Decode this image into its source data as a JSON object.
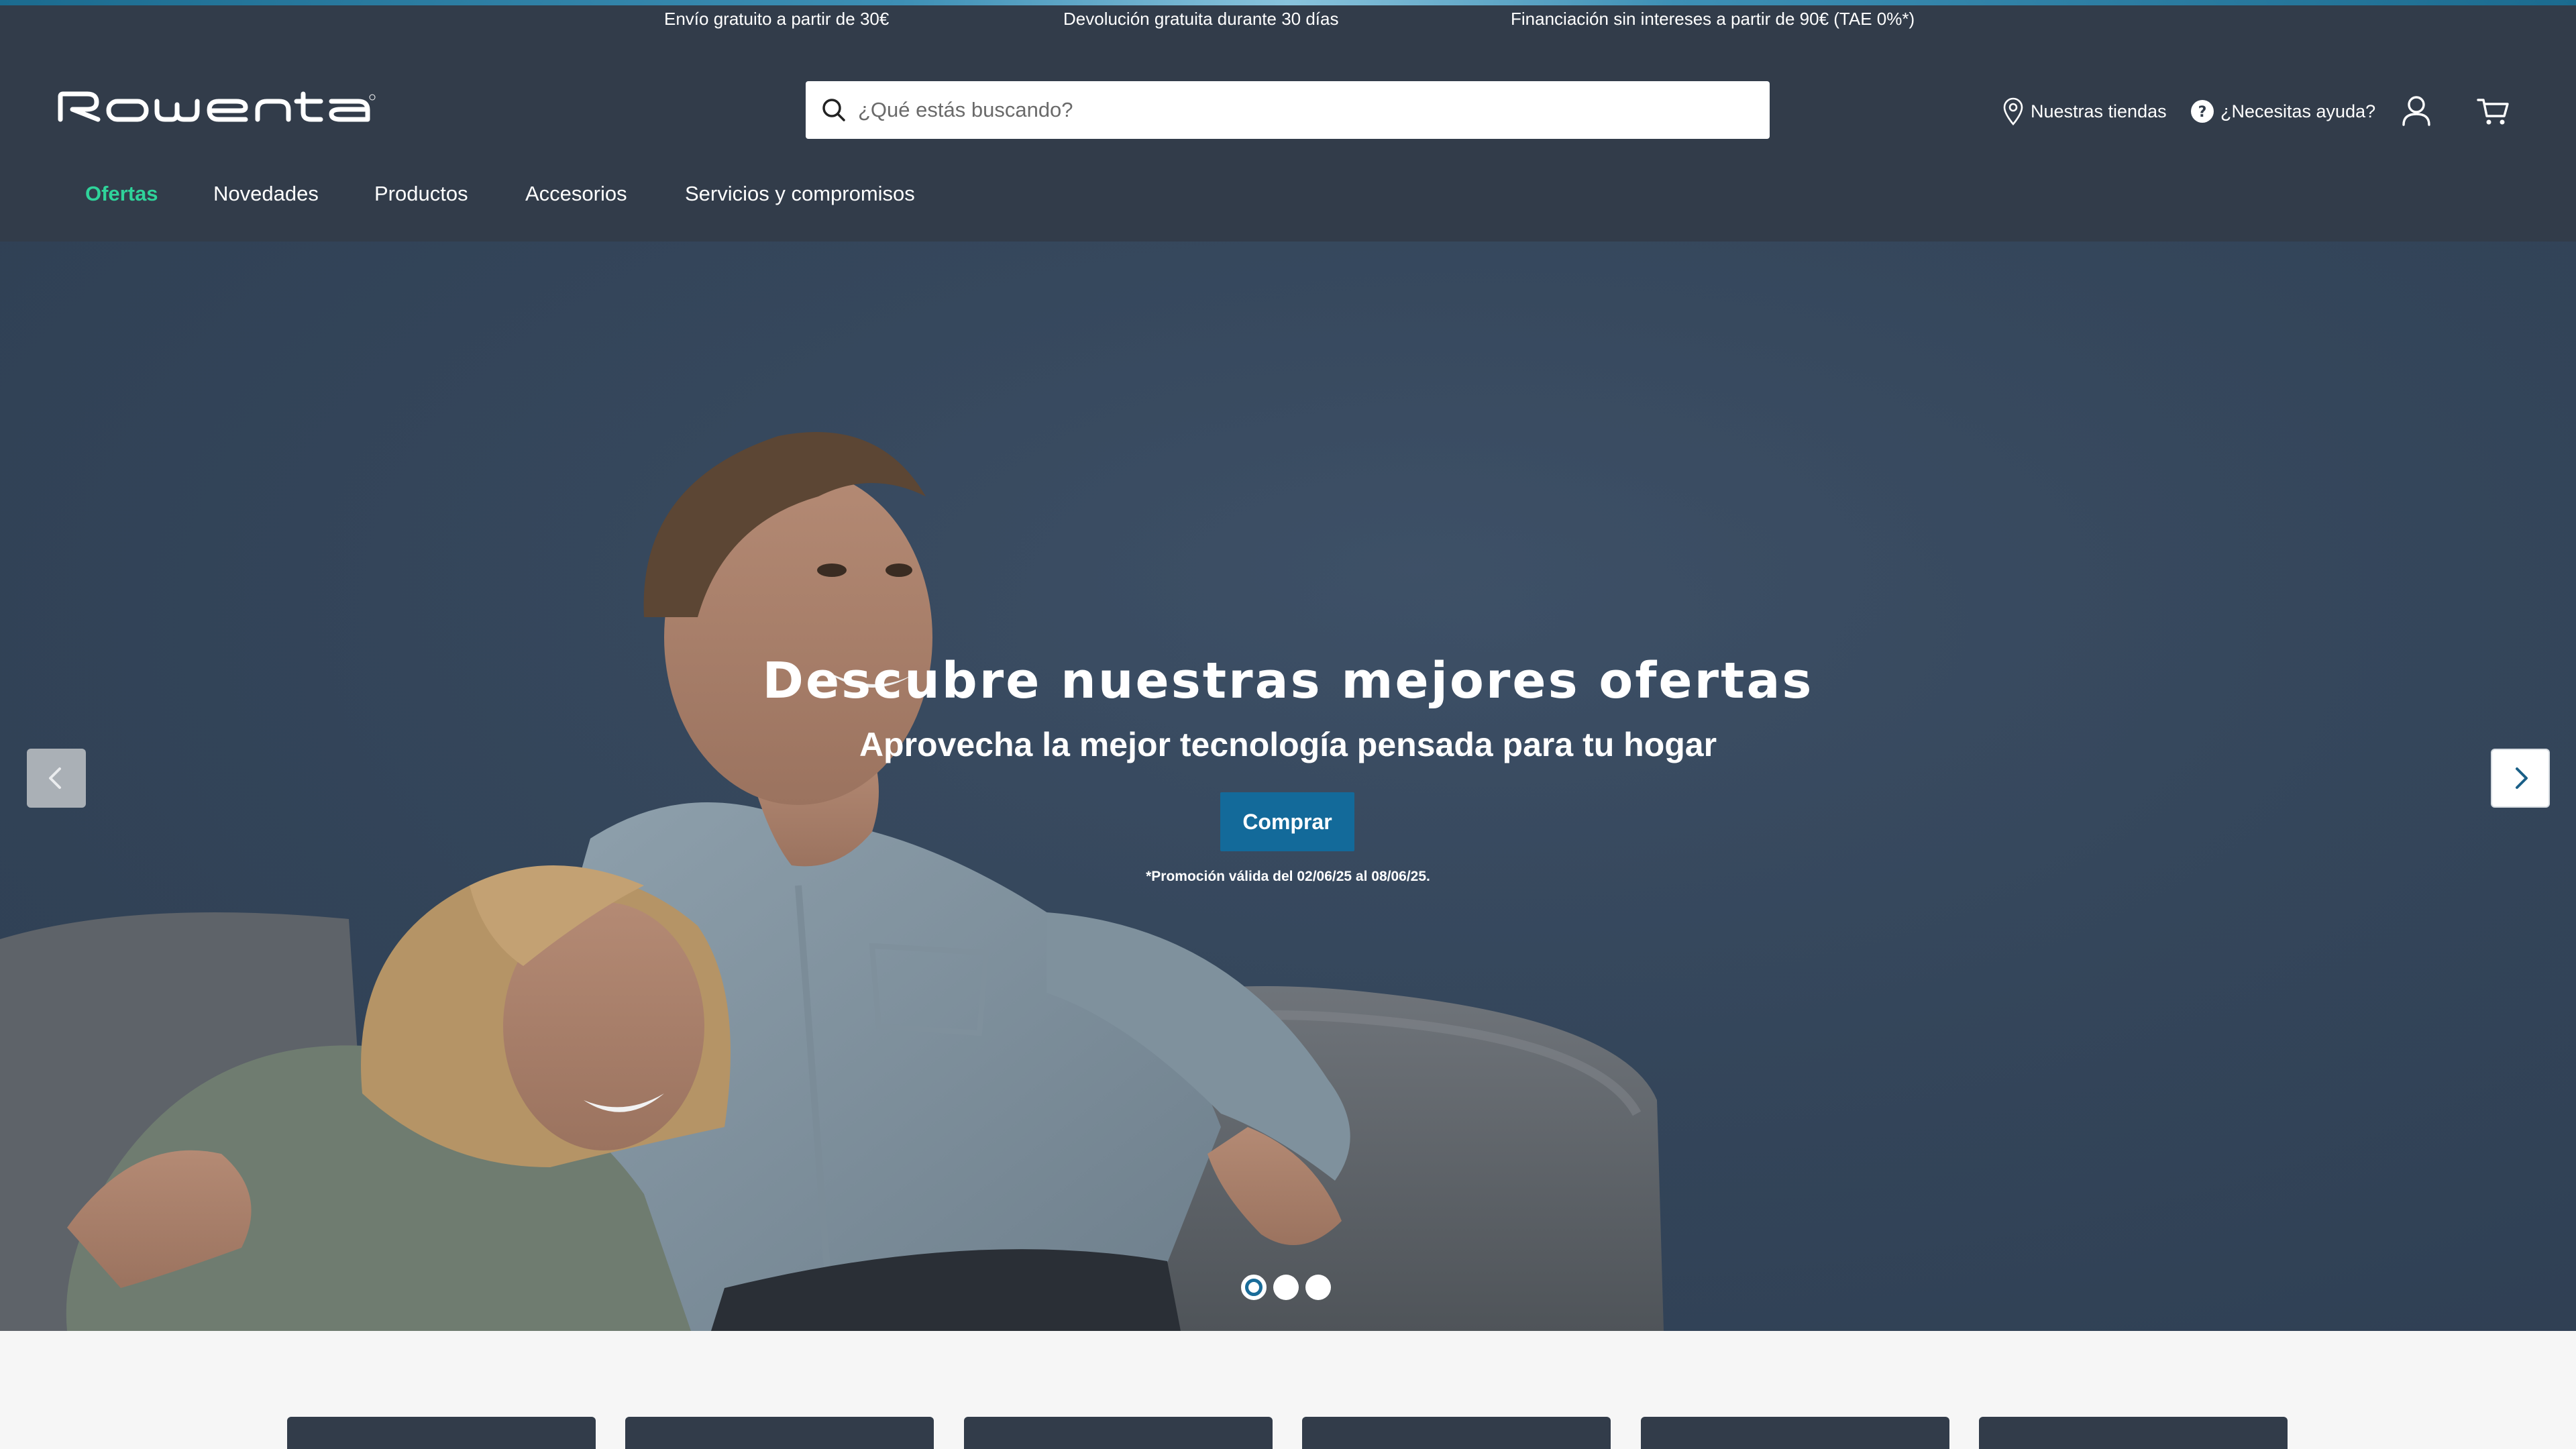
{
  "promo_bar": {
    "messages": [
      "Envío gratuito a partir de 30€",
      "Devolución gratuita durante 30 días",
      "Financiación sin intereses a partir de 90€ (TAE 0%*)"
    ]
  },
  "header": {
    "logo": "Rowenta",
    "search": {
      "placeholder": "¿Qué estás buscando?",
      "value": ""
    },
    "utility": {
      "stores_label": "Nuestras tiendas",
      "help_label": "¿Necesitas ayuda?"
    },
    "icons": [
      "location-pin-icon",
      "help-circle-icon",
      "user-icon",
      "cart-icon",
      "search-icon"
    ]
  },
  "nav": {
    "items": [
      "Ofertas",
      "Novedades",
      "Productos",
      "Accesorios",
      "Servicios y compromisos"
    ],
    "active_index": 0
  },
  "hero": {
    "title": "Descubre nuestras mejores ofertas",
    "subtitle": "Aprovecha la mejor tecnología pensada para tu hogar",
    "cta_label": "Comprar",
    "disclaimer": "*Promoción válida del 02/06/25 al 08/06/25.",
    "carousel": {
      "slide_count": 3,
      "active_slide": 1
    }
  },
  "colors": {
    "header_bg": "#323c4a",
    "active_nav": "#2fd39a",
    "cta_bg": "#136a9a",
    "page_bg": "#f6f6f6"
  }
}
